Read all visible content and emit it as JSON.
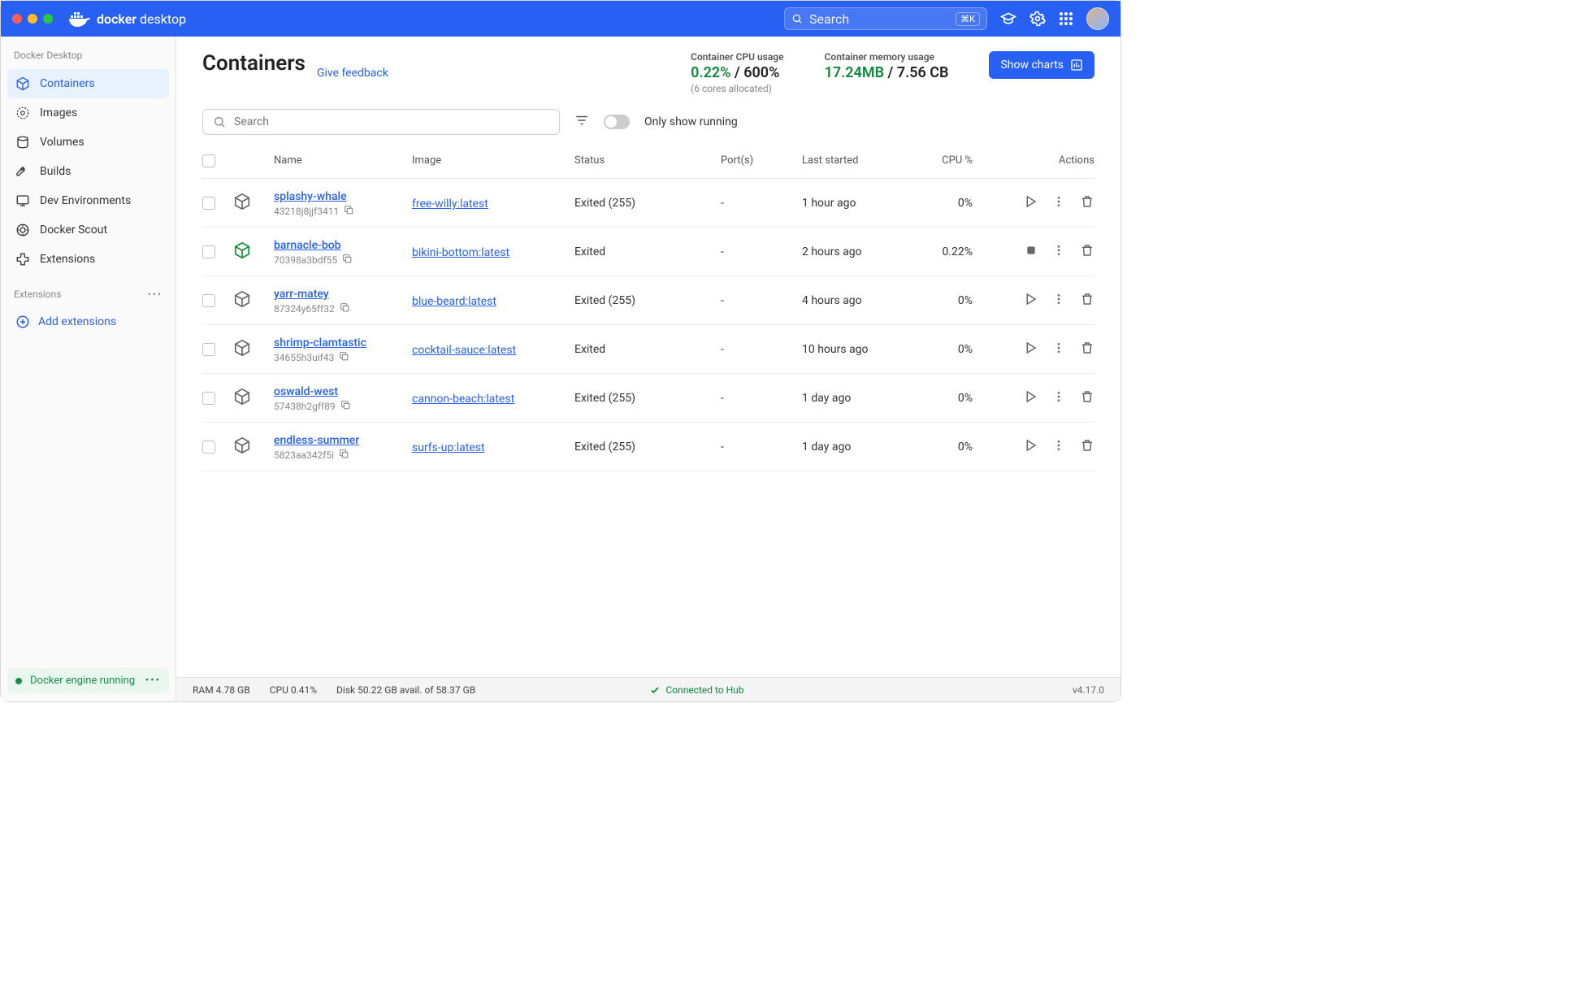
{
  "app": {
    "brand_bold": "docker",
    "brand_light": "desktop",
    "search_placeholder": "Search",
    "kbd": "⌘K"
  },
  "sidebar": {
    "section_label": "Docker Desktop",
    "items": [
      {
        "label": "Containers"
      },
      {
        "label": "Images"
      },
      {
        "label": "Volumes"
      },
      {
        "label": "Builds"
      },
      {
        "label": "Dev Environments"
      },
      {
        "label": "Docker Scout"
      },
      {
        "label": "Extensions"
      }
    ],
    "ext_label": "Extensions",
    "add_ext": "Add extensions",
    "engine": "Docker engine running"
  },
  "header": {
    "title": "Containers",
    "feedback": "Give feedback",
    "cpu": {
      "label": "Container CPU usage",
      "used": "0.22%",
      "total": "/ 600%",
      "sub": "(6 cores allocated)"
    },
    "mem": {
      "label": "Container memory usage",
      "used": "17.24MB",
      "total": "/ 7.56 CB"
    },
    "show_charts": "Show charts"
  },
  "toolbar": {
    "search_placeholder": "Search",
    "only_running": "Only show running"
  },
  "columns": {
    "name": "Name",
    "image": "Image",
    "status": "Status",
    "ports": "Port(s)",
    "last": "Last started",
    "cpu": "CPU %",
    "actions": "Actions"
  },
  "rows": [
    {
      "name": "splashy-whale",
      "hash": "43218j8jjf3411",
      "image": "free-willy:latest",
      "status": "Exited (255)",
      "ports": "-",
      "last": "1 hour ago",
      "cpu": "0%",
      "running": false,
      "action": "play"
    },
    {
      "name": "barnacle-bob",
      "hash": "70398a3bdf55",
      "image": "bikini-bottom:latest",
      "status": "Exited",
      "ports": "-",
      "last": "2 hours ago",
      "cpu": "0.22%",
      "running": true,
      "action": "stop"
    },
    {
      "name": "yarr-matey",
      "hash": "87324y65ff32",
      "image": "blue-beard:latest",
      "status": "Exited (255)",
      "ports": "-",
      "last": "4 hours ago",
      "cpu": "0%",
      "running": false,
      "action": "play"
    },
    {
      "name": "shrimp-clamtastic",
      "hash": "34655h3uif43",
      "image": "cocktail-sauce:latest",
      "status": "Exited",
      "ports": "-",
      "last": "10 hours ago",
      "cpu": "0%",
      "running": false,
      "action": "play"
    },
    {
      "name": "oswald-west",
      "hash": "57438h2gff89",
      "image": "cannon-beach:latest",
      "status": "Exited (255)",
      "ports": "-",
      "last": "1 day ago",
      "cpu": "0%",
      "running": false,
      "action": "play"
    },
    {
      "name": "endless-summer",
      "hash": "5823aa342f5i",
      "image": "surfs-up:latest",
      "status": "Exited (255)",
      "ports": "-",
      "last": "1 day ago",
      "cpu": "0%",
      "running": false,
      "action": "play"
    }
  ],
  "footer": {
    "ram": "RAM 4.78 GB",
    "cpu": "CPU 0.41%",
    "disk": "Disk 50.22 GB avail. of 58.37 GB",
    "hub": "Connected to Hub",
    "version": "v4.17.0"
  }
}
